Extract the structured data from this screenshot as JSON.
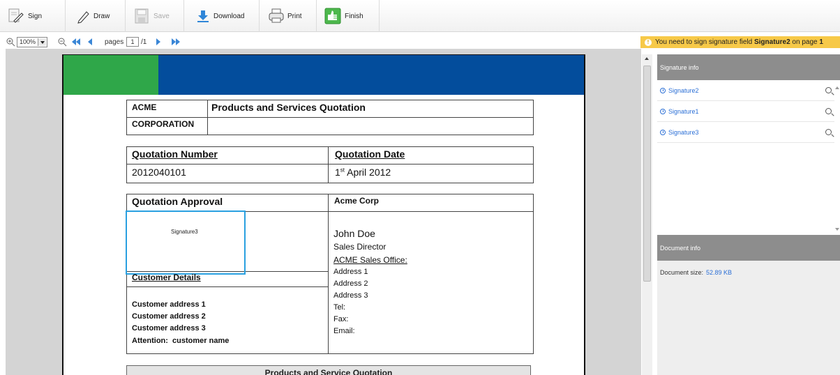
{
  "toolbar": {
    "sign": "Sign",
    "draw": "Draw",
    "save": "Save",
    "download": "Download",
    "print": "Print",
    "finish": "Finish"
  },
  "nav": {
    "zoom": "100%",
    "pages_label": "pages",
    "current_page": "1",
    "total_pages": "/1"
  },
  "alert": {
    "prefix": "You need to sign signature field ",
    "field": "Signature2",
    "middle": " on page ",
    "page": "1"
  },
  "document": {
    "company_line1": "ACME",
    "company_line2": "CORPORATION",
    "title": "Products and Services Quotation",
    "quotation_number_label": "Quotation Number",
    "quotation_number": "2012040101",
    "quotation_date_label": "Quotation Date",
    "quotation_date_day": "1",
    "quotation_date_suffix": "st",
    "quotation_date_rest": " April 2012",
    "approval_label": "Quotation Approval",
    "acme_corp": "Acme Corp",
    "signature_field": "Signature3",
    "contact_name": "John Doe",
    "contact_title": "Sales Director",
    "sales_office": "ACME Sales Office:",
    "address1": "Address 1",
    "address2": "Address 2",
    "address3": "Address 3",
    "tel": "Tel:",
    "fax": "Fax:",
    "email": "Email:",
    "customer_details": "Customer Details",
    "customer_address1": "Customer address 1",
    "customer_address2": "Customer address 2",
    "customer_address3": "Customer address 3",
    "attention": "Attention:  customer name",
    "products_heading": "Products and Service Quotation"
  },
  "side": {
    "signature_info": "Signature info",
    "signatures": [
      "Signature2",
      "Signature1",
      "Signature3"
    ],
    "document_info": "Document info",
    "doc_size_label": "Document size:",
    "doc_size_value": "52.89 KB"
  },
  "colors": {
    "green_banner": "#2fa749",
    "blue_banner": "#034d9c",
    "alert": "#f7c948",
    "link": "#2b6fd6"
  }
}
